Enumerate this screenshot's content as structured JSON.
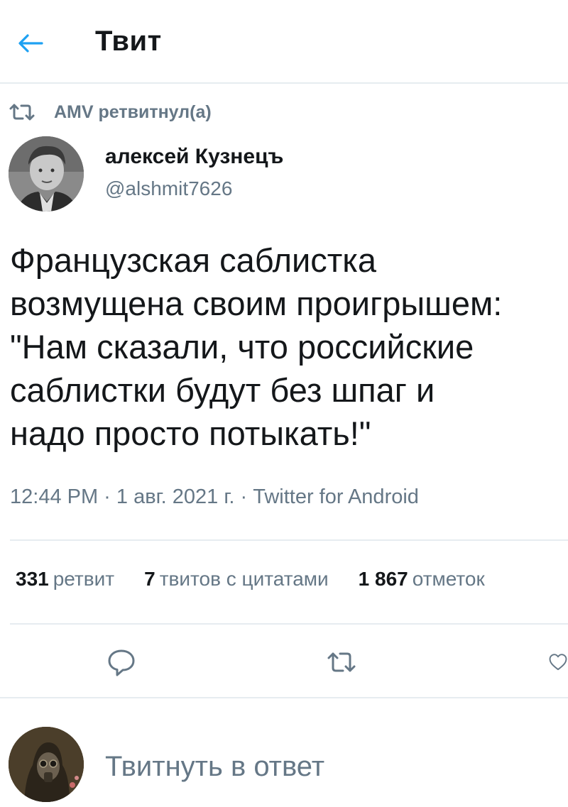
{
  "header": {
    "title": "Твит"
  },
  "retweet": {
    "text": "AMV ретвитнул(а)"
  },
  "author": {
    "name": "алексей Кузнецъ",
    "handle": "@alshmit7626"
  },
  "tweet": {
    "text": "Французская саблистка\nвозмущена своим проигрышем:\n\"Нам сказали, что российские\nсаблистки будут без шпаг и\nнадо просто потыкать!\""
  },
  "meta": {
    "timestamp": "12:44 PM · 1 авг. 2021 г. · Twitter for Android"
  },
  "stats": {
    "retweets_count": "331",
    "retweets_label": "ретвит",
    "quotes_count": "7",
    "quotes_label": "твитов с цитатами",
    "likes_count": "1 867",
    "likes_label": "отметок"
  },
  "reply": {
    "placeholder": "Твитнуть в ответ"
  },
  "colors": {
    "accent": "#1da1f2",
    "secondary_text": "#657786",
    "divider": "#e6ecf0"
  },
  "icons": {
    "back": "arrow-left-icon",
    "retweet": "retweet-icon",
    "reply": "reply-icon",
    "like": "heart-icon"
  }
}
